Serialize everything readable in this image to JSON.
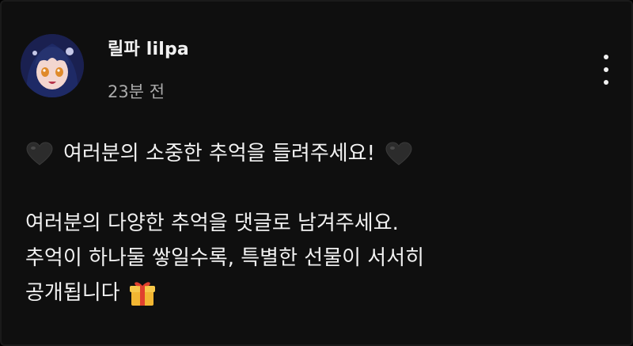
{
  "post": {
    "author": "릴파 lilpa",
    "timestamp": "23분 전",
    "avatar_icon": "avatar-image",
    "menu_icon": "more-vertical-icon",
    "headline": "여러분의 소중한 추억을 들려주세요!",
    "headline_emoji": "black-heart-icon",
    "body_lines": [
      "여러분의 다양한 추억을 댓글로 남겨주세요.",
      "추억이 하나둘 쌓일수록, 특별한 선물이 서서히",
      "공개됩니다"
    ],
    "trailing_emoji": "gift-icon"
  },
  "colors": {
    "background": "#0f0f0f",
    "text": "#f1f1f1",
    "secondary_text": "#aaaaaa"
  }
}
